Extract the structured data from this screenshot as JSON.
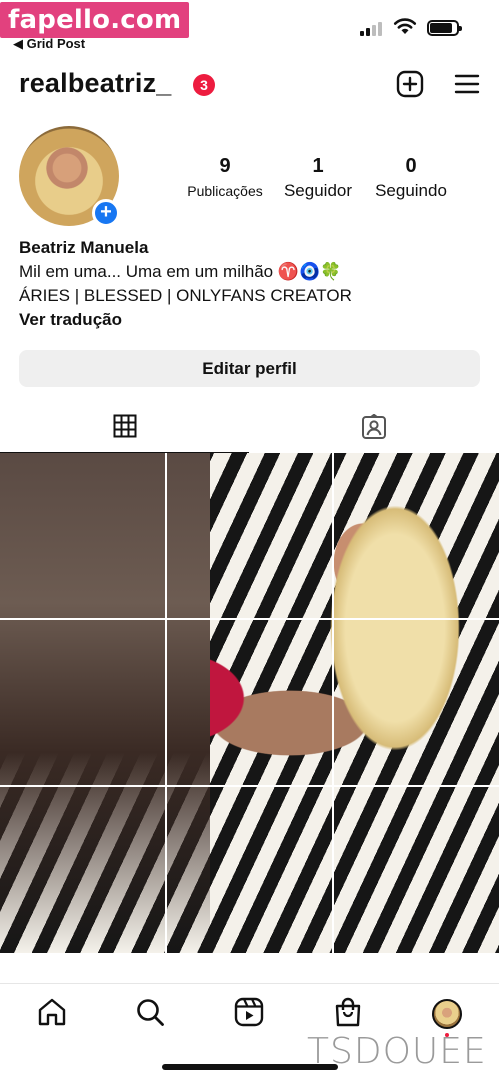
{
  "watermark_top": "fapello.com",
  "watermark_bottom": "TSDOUEE",
  "status_bar": {
    "back_label": "◀ Grid Post"
  },
  "header": {
    "username": "realbeatriz_",
    "notification_count": "3",
    "new_post_icon": "plus-square-icon",
    "menu_icon": "hamburger-menu-icon"
  },
  "profile": {
    "stats": [
      {
        "value": "9",
        "label": "Publicações"
      },
      {
        "value": "1",
        "label": "Seguidor"
      },
      {
        "value": "0",
        "label": "Seguindo"
      }
    ],
    "name": "Beatriz Manuela",
    "bio_line1": "Mil em uma... Uma em um milhão ♈️🧿🍀",
    "bio_line2": "ÁRIES | BLESSED | ONLYFANS CREATOR",
    "translate_label": "Ver tradução",
    "edit_button": "Editar perfil"
  },
  "tabs": [
    {
      "name": "grid-tab",
      "icon": "grid-icon",
      "active": true
    },
    {
      "name": "tagged-tab",
      "icon": "tagged-person-icon",
      "active": false
    }
  ],
  "grid": {
    "columns": 3,
    "rows": 3
  },
  "bottom_nav": [
    {
      "name": "home",
      "icon": "home-icon"
    },
    {
      "name": "search",
      "icon": "search-icon"
    },
    {
      "name": "reels",
      "icon": "reels-icon"
    },
    {
      "name": "shop",
      "icon": "shopping-bag-icon"
    },
    {
      "name": "profile",
      "icon": "profile-avatar"
    }
  ],
  "colors": {
    "badge": "#ed1c3f",
    "add_avatar": "#1877f2",
    "watermark": "#e2417e",
    "edit_button_bg": "#efefef"
  }
}
